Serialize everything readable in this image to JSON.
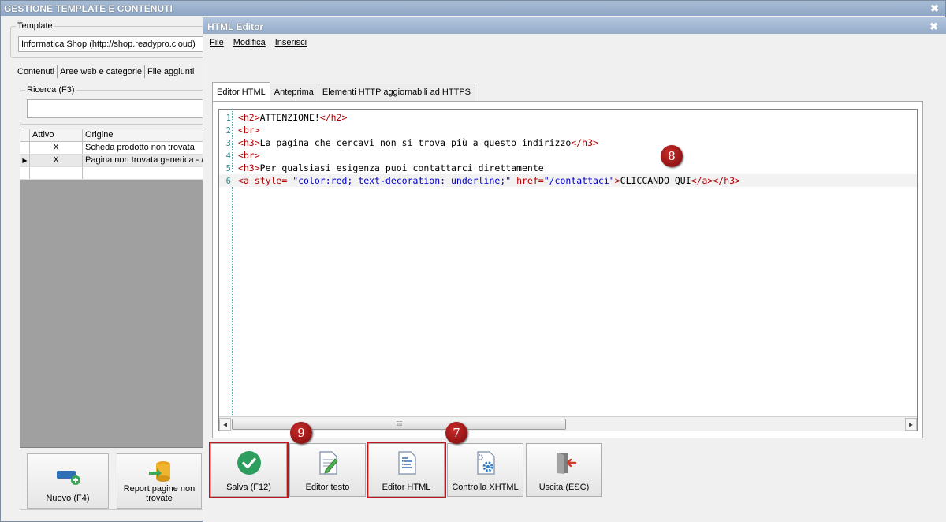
{
  "background_window": {
    "title": "GESTIONE TEMPLATE E CONTENUTI",
    "close_glyph": "✖",
    "template_group": {
      "legend": "Template",
      "value": "Informatica Shop (http://shop.readypro.cloud)"
    },
    "tabs": [
      "Contenuti",
      "Aree web e categorie",
      "File aggiunti"
    ],
    "search": {
      "legend": "Ricerca (F3)",
      "value": ""
    },
    "grid": {
      "columns": [
        "Attivo",
        "Origine"
      ],
      "rows": [
        {
          "attivo": "X",
          "origine": "Scheda prodotto non trovata"
        },
        {
          "attivo": "X",
          "origine": "Pagina non trovata generica - /"
        }
      ]
    },
    "toolbar": {
      "nuovo_label": "Nuovo (F4)",
      "report_label": "Report pagine non trovate"
    }
  },
  "editor": {
    "title": "HTML Editor",
    "close_glyph": "✖",
    "menu": [
      "File",
      "Modifica",
      "Inserisci"
    ],
    "tabs": [
      "Editor HTML",
      "Anteprima",
      "Elementi HTTP aggiornabili ad HTTPS"
    ],
    "active_tab": 0,
    "code_lines": [
      {
        "num": "1",
        "open": "<h2>",
        "text": "ATTENZIONE!",
        "close": "</h2>"
      },
      {
        "num": "2",
        "open": "<br>",
        "text": "",
        "close": ""
      },
      {
        "num": "3",
        "open": "<h3>",
        "text": "La pagina che cercavi non si trova più a questo indirizzo",
        "close": "</h3>"
      },
      {
        "num": "4",
        "open": "<br>",
        "text": "",
        "close": ""
      },
      {
        "num": "5",
        "open": "<h3>",
        "text": "Per qualsiasi esigenza puoi contattarci direttamente",
        "close": ""
      },
      {
        "num": "6",
        "a_open": "<a ",
        "attr1": "style=",
        "val1": " \"color:red; text-decoration: underline;\" ",
        "attr2": "href=",
        "val2": "\"/contattaci\"",
        "gt": ">",
        "text": "CLICCANDO QUI",
        "close1": "</a>",
        "close2": "</h3>"
      }
    ],
    "scroll_grip": "⁞⁞⁞⁞⁞⁞",
    "buttons": {
      "salva": "Salva (F12)",
      "editor_testo": "Editor testo",
      "editor_html": "Editor HTML",
      "controlla": "Controlla XHTML",
      "uscita": "Uscita (ESC)"
    },
    "badges": {
      "b7": "7",
      "b8": "8",
      "b9": "9"
    },
    "colors": {
      "highlight": "#c0141c",
      "badge": "#8b1010",
      "check": "#2e9e5e"
    }
  }
}
